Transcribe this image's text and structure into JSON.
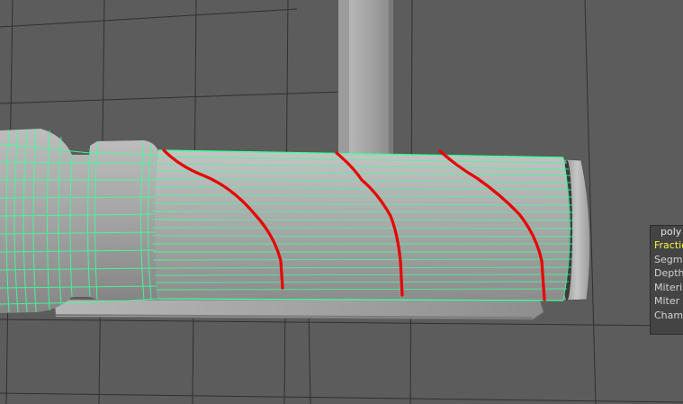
{
  "viewport": {
    "colors": {
      "background": "#5c5c5c",
      "grid": "#303030",
      "mesh_body": "#a8a8a8",
      "wireframe": "#3dff9a",
      "annotation": "#e80000"
    }
  },
  "hud": {
    "title": "poly",
    "rows": [
      {
        "label": "Fractio",
        "active": true
      },
      {
        "label": "Segme",
        "active": false
      },
      {
        "label": "Depth",
        "active": false
      },
      {
        "label": "Miterin",
        "active": false
      },
      {
        "label": "Miter A",
        "active": false
      },
      {
        "label": "Chamf",
        "active": false
      }
    ]
  }
}
